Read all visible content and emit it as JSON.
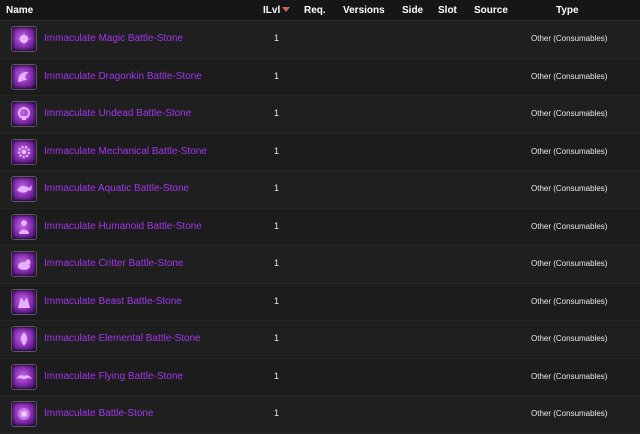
{
  "columns": {
    "name": "Name",
    "ilvl": "ILvl",
    "req": "Req.",
    "versions": "Versions",
    "side": "Side",
    "slot": "Slot",
    "source": "Source",
    "type": "Type"
  },
  "colors": {
    "epic": "#a335ee",
    "sort_arrow": "#c06a5a"
  },
  "sort": {
    "column": "ILvl",
    "direction": "descending"
  },
  "items": [
    {
      "name": "Immaculate Magic Battle-Stone",
      "ilvl": "1",
      "type": "Other (Consumables)",
      "icon": "magic-stone-icon"
    },
    {
      "name": "Immaculate Dragonkin Battle-Stone",
      "ilvl": "1",
      "type": "Other (Consumables)",
      "icon": "dragonkin-stone-icon"
    },
    {
      "name": "Immaculate Undead Battle-Stone",
      "ilvl": "1",
      "type": "Other (Consumables)",
      "icon": "undead-stone-icon"
    },
    {
      "name": "Immaculate Mechanical Battle-Stone",
      "ilvl": "1",
      "type": "Other (Consumables)",
      "icon": "mechanical-stone-icon"
    },
    {
      "name": "Immaculate Aquatic Battle-Stone",
      "ilvl": "1",
      "type": "Other (Consumables)",
      "icon": "aquatic-stone-icon"
    },
    {
      "name": "Immaculate Humanoid Battle-Stone",
      "ilvl": "1",
      "type": "Other (Consumables)",
      "icon": "humanoid-stone-icon"
    },
    {
      "name": "Immaculate Critter Battle-Stone",
      "ilvl": "1",
      "type": "Other (Consumables)",
      "icon": "critter-stone-icon"
    },
    {
      "name": "Immaculate Beast Battle-Stone",
      "ilvl": "1",
      "type": "Other (Consumables)",
      "icon": "beast-stone-icon"
    },
    {
      "name": "Immaculate Elemental Battle-Stone",
      "ilvl": "1",
      "type": "Other (Consumables)",
      "icon": "elemental-stone-icon"
    },
    {
      "name": "Immaculate Flying Battle-Stone",
      "ilvl": "1",
      "type": "Other (Consumables)",
      "icon": "flying-stone-icon"
    },
    {
      "name": "Immaculate Battle-Stone",
      "ilvl": "1",
      "type": "Other (Consumables)",
      "icon": "battle-stone-icon"
    }
  ]
}
